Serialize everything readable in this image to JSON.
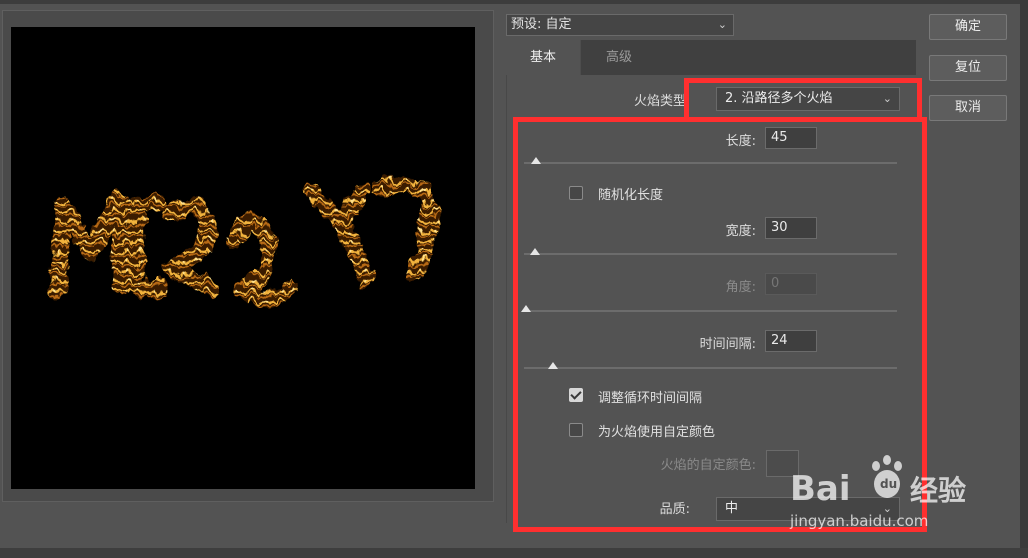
{
  "preset": {
    "label": "预设: 自定"
  },
  "buttons": {
    "ok": "确定",
    "reset": "复位",
    "cancel": "取消"
  },
  "tabs": [
    {
      "label": "基本",
      "active": true
    },
    {
      "label": "高级",
      "active": false
    }
  ],
  "flame_type": {
    "label": "火焰类型",
    "value": "2. 沿路径多个火焰"
  },
  "controls": {
    "length": {
      "label": "长度:",
      "value": "45"
    },
    "randomize_length": {
      "label": "随机化长度",
      "checked": false
    },
    "width": {
      "label": "宽度:",
      "value": "30"
    },
    "angle": {
      "label": "角度:",
      "value": "0",
      "disabled": true
    },
    "interval": {
      "label": "时间间隔:",
      "value": "24"
    },
    "adjust_loop": {
      "label": "调整循环时间间隔",
      "checked": true
    },
    "custom_color": {
      "label": "为火焰使用自定颜色",
      "checked": false
    },
    "custom_color_field": {
      "label": "火焰的自定颜色:"
    },
    "quality": {
      "label": "品质:",
      "value": "中"
    }
  },
  "watermark": {
    "brand_latin": "Bai",
    "brand_cn": "经验",
    "url": "jingyan.baidu.com"
  },
  "colors": {
    "highlight": "#ff2f2f",
    "flame": "#d8962a",
    "panel": "#535353"
  }
}
